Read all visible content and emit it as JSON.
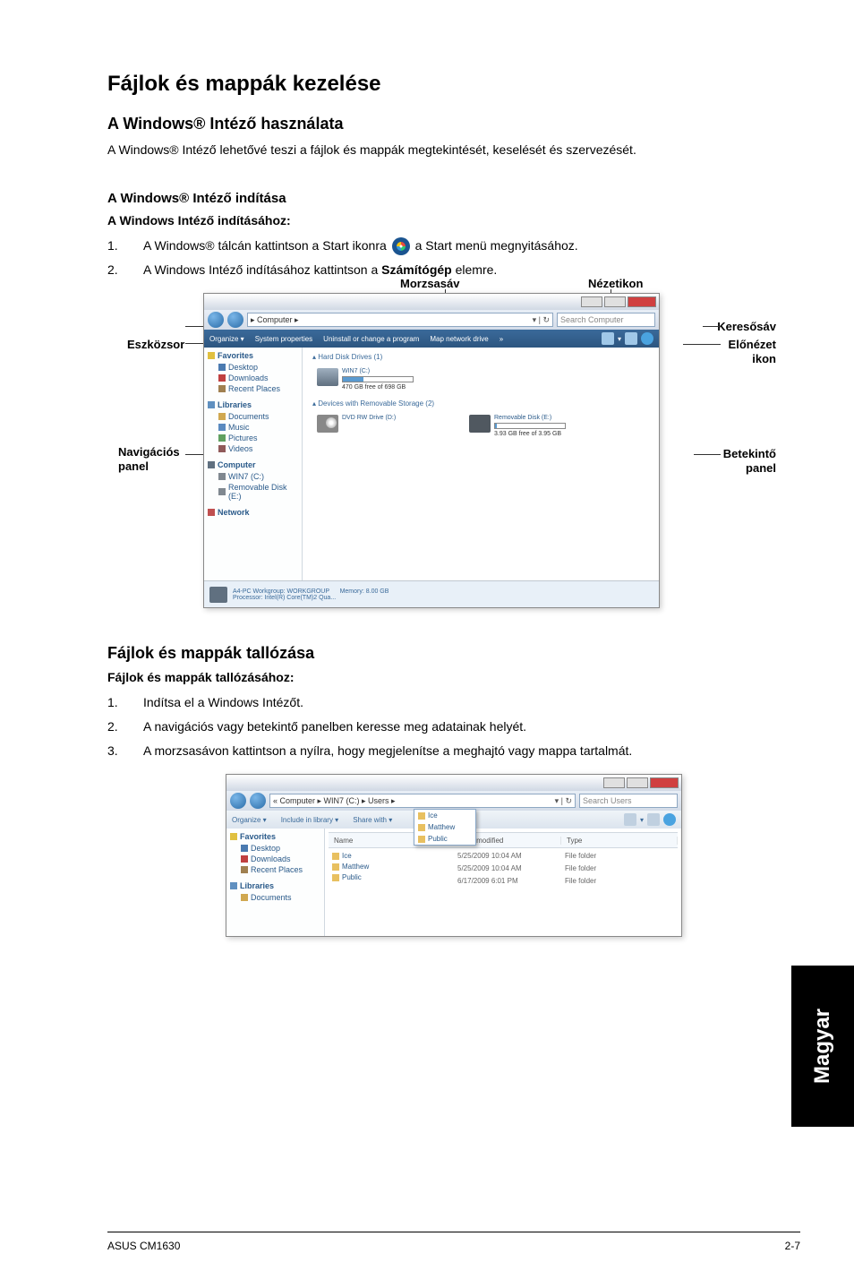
{
  "language_tab": "Magyar",
  "footer": {
    "left": "ASUS CM1630",
    "right": "2-7"
  },
  "main_heading": "Fájlok és mappák kezelése",
  "section1": {
    "title": "A Windows® Intéző használata",
    "intro": "A Windows® Intéző lehetővé teszi a fájlok és mappák megtekintését, keselését és szervezését.",
    "sub1": "A Windows® Intéző indítása",
    "sub1_steps_title": "A Windows Intéző indításához:",
    "step1_a": "A Windows® tálcán kattintson a Start ikonra ",
    "step1_b": " a Start menü megnyitásához.",
    "step2_a": "A Windows Intéző indításához kattintson a ",
    "step2_bold": "Számítógép",
    "step2_b": " elemre."
  },
  "labels": {
    "morzsa": "Morzsasáv",
    "nezetikon": "Nézetikon",
    "eszkozsor": "Eszközsor",
    "navpanel1": "Navigációs",
    "navpanel2": "panel",
    "keresosav": "Keresősáv",
    "elonezet1": "Előnézet",
    "elonezet2": "ikon",
    "betekinto1": "Betekintő",
    "betekinto2": "panel"
  },
  "explorer1": {
    "addr": "▸ Computer ▸",
    "search_ph": "Search Computer",
    "toolbar": {
      "organize": "Organize ▾",
      "sysprop": "System properties",
      "uninstall": "Uninstall or change a program",
      "mapdrive": "Map network drive",
      "more": "»"
    },
    "nav": {
      "favorites": "Favorites",
      "desktop": "Desktop",
      "downloads": "Downloads",
      "recent": "Recent Places",
      "libraries": "Libraries",
      "documents": "Documents",
      "music": "Music",
      "pictures": "Pictures",
      "videos": "Videos",
      "computer": "Computer",
      "hdd": "WIN7 (C:)",
      "remov": "Removable Disk (E:)",
      "network": "Network"
    },
    "hdd_section": "▴ Hard Disk Drives (1)",
    "hdd_name": "WIN7 (C:)",
    "hdd_free": "470 GB free of 698 GB",
    "removable_section": "▴ Devices with Removable Storage (2)",
    "dvd_name": "DVD RW Drive (D:)",
    "rem_name": "Removable Disk (E:)",
    "rem_free": "3.93 GB free of 3.95 GB",
    "status_wg": "A4-PC Workgroup: WORKGROUP",
    "status_proc": "Processor: Intel(R) Core(TM)2 Qua...",
    "status_mem": "Memory: 8.00 GB"
  },
  "section2": {
    "title": "Fájlok és mappák tallózása",
    "steps_title": "Fájlok és mappák tallózásához:",
    "step1": "Indítsa el a Windows Intézőt.",
    "step2": "A navigációs vagy betekintő panelben keresse meg adatainak helyét.",
    "step3": "A morzsasávon kattintson a nyílra, hogy megjelenítse a meghajtó vagy mappa tartalmát."
  },
  "explorer2": {
    "addr": "« Computer ▸ WIN7 (C:) ▸ Users ▸",
    "search_ph": "Search Users",
    "toolbar": {
      "organize": "Organize ▾",
      "include": "Include in library ▾",
      "share": "Share with ▾"
    },
    "dropdown": {
      "ice": "Ice",
      "matthew": "Matthew",
      "public": "Public"
    },
    "nav": {
      "favorites": "Favorites",
      "name": "Name",
      "desktop": "Desktop",
      "downloads": "Downloads",
      "recent": "Recent Places",
      "libraries": "Libraries",
      "documents": "Documents"
    },
    "headers": {
      "date": "Date modified",
      "type": "Type"
    },
    "folders": {
      "ice": "Ice",
      "matthew": "Matthew",
      "public": "Public"
    },
    "rows": [
      {
        "date": "5/25/2009 10:04 AM",
        "type": "File folder"
      },
      {
        "date": "5/25/2009 10:04 AM",
        "type": "File folder"
      },
      {
        "date": "6/17/2009 6:01 PM",
        "type": "File folder"
      }
    ]
  }
}
